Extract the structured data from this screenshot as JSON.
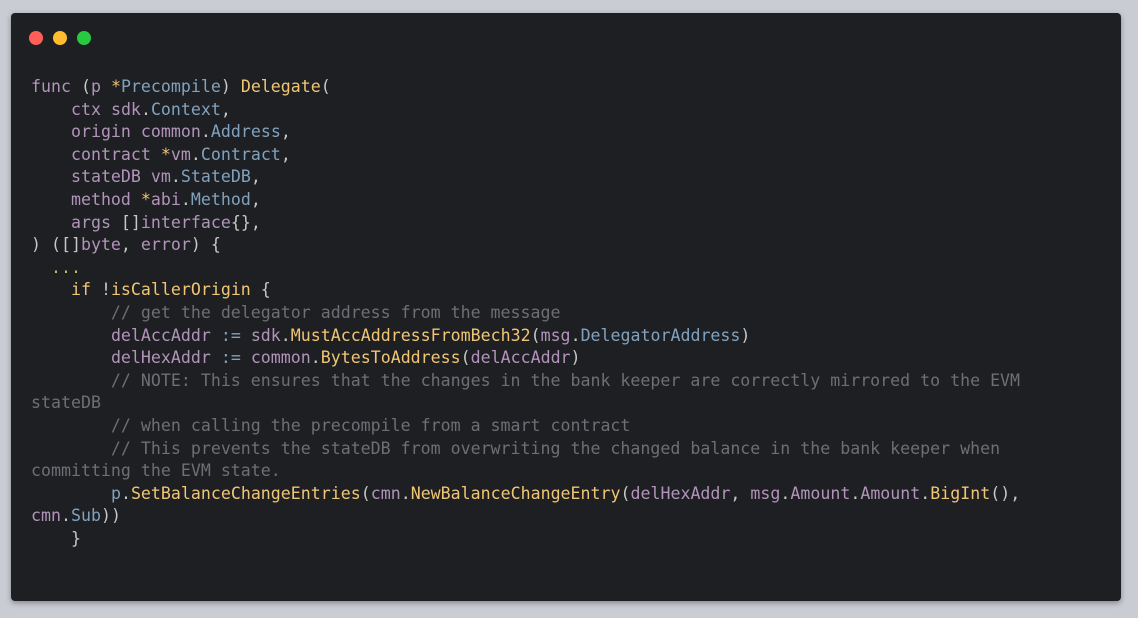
{
  "window": {
    "controls": [
      {
        "name": "close",
        "color": "#ff5f57"
      },
      {
        "name": "minimize",
        "color": "#febc2e"
      },
      {
        "name": "zoom",
        "color": "#28c840"
      }
    ]
  },
  "colors": {
    "keyword": "#b294bb",
    "type": "#81a2be",
    "func": "#f0c674",
    "plain": "#c5c8c6",
    "comment": "#6c6f73",
    "ellipsis": "#b5bd68"
  },
  "code": {
    "lines": [
      [
        [
          "func",
          "keyword"
        ],
        [
          " (",
          "plain"
        ],
        [
          "p",
          "keyword"
        ],
        [
          " *",
          "func"
        ],
        [
          "Precompile",
          "type"
        ],
        [
          ") ",
          "plain"
        ],
        [
          "Delegate",
          "func"
        ],
        [
          "(",
          "plain"
        ]
      ],
      [
        [
          "    ",
          "plain"
        ],
        [
          "ctx",
          "keyword"
        ],
        [
          " ",
          "plain"
        ],
        [
          "sdk",
          "keyword"
        ],
        [
          ".",
          "plain"
        ],
        [
          "Context",
          "type"
        ],
        [
          ",",
          "plain"
        ]
      ],
      [
        [
          "    ",
          "plain"
        ],
        [
          "origin",
          "keyword"
        ],
        [
          " ",
          "plain"
        ],
        [
          "common",
          "keyword"
        ],
        [
          ".",
          "plain"
        ],
        [
          "Address",
          "type"
        ],
        [
          ",",
          "plain"
        ]
      ],
      [
        [
          "    ",
          "plain"
        ],
        [
          "contract",
          "keyword"
        ],
        [
          " *",
          "func"
        ],
        [
          "vm",
          "keyword"
        ],
        [
          ".",
          "plain"
        ],
        [
          "Contract",
          "type"
        ],
        [
          ",",
          "plain"
        ]
      ],
      [
        [
          "    ",
          "plain"
        ],
        [
          "stateDB",
          "keyword"
        ],
        [
          " ",
          "plain"
        ],
        [
          "vm",
          "keyword"
        ],
        [
          ".",
          "plain"
        ],
        [
          "StateDB",
          "type"
        ],
        [
          ",",
          "plain"
        ]
      ],
      [
        [
          "    ",
          "plain"
        ],
        [
          "method",
          "keyword"
        ],
        [
          " *",
          "func"
        ],
        [
          "abi",
          "keyword"
        ],
        [
          ".",
          "plain"
        ],
        [
          "Method",
          "type"
        ],
        [
          ",",
          "plain"
        ]
      ],
      [
        [
          "    ",
          "plain"
        ],
        [
          "args",
          "keyword"
        ],
        [
          " []",
          "plain"
        ],
        [
          "interface",
          "keyword"
        ],
        [
          "{},",
          "plain"
        ]
      ],
      [
        [
          ") ([]",
          "plain"
        ],
        [
          "byte",
          "keyword"
        ],
        [
          ", ",
          "plain"
        ],
        [
          "error",
          "keyword"
        ],
        [
          ") {",
          "plain"
        ]
      ],
      [
        [
          "  ...",
          "ellipsis"
        ]
      ],
      [
        [
          "    ",
          "plain"
        ],
        [
          "if",
          "func"
        ],
        [
          " !",
          "plain"
        ],
        [
          "isCallerOrigin",
          "func"
        ],
        [
          " {",
          "plain"
        ]
      ],
      [
        [
          "        // get the delegator address from the message",
          "comment"
        ]
      ],
      [
        [
          "        ",
          "plain"
        ],
        [
          "delAccAddr",
          "keyword"
        ],
        [
          " := ",
          "type"
        ],
        [
          "sdk",
          "keyword"
        ],
        [
          ".",
          "plain"
        ],
        [
          "MustAccAddressFromBech32",
          "func"
        ],
        [
          "(",
          "plain"
        ],
        [
          "msg",
          "keyword"
        ],
        [
          ".",
          "plain"
        ],
        [
          "DelegatorAddress",
          "type"
        ],
        [
          ")",
          "plain"
        ]
      ],
      [
        [
          "        ",
          "plain"
        ],
        [
          "delHexAddr",
          "keyword"
        ],
        [
          " := ",
          "type"
        ],
        [
          "common",
          "keyword"
        ],
        [
          ".",
          "plain"
        ],
        [
          "BytesToAddress",
          "func"
        ],
        [
          "(",
          "plain"
        ],
        [
          "delAccAddr",
          "keyword"
        ],
        [
          ")",
          "plain"
        ]
      ],
      [
        [
          "        // NOTE: This ensures that the changes in the bank keeper are correctly mirrored to the EVM",
          "comment"
        ]
      ],
      [
        [
          "stateDB",
          "comment"
        ]
      ],
      [
        [
          "        // when calling the precompile from a smart contract",
          "comment"
        ]
      ],
      [
        [
          "        // This prevents the stateDB from overwriting the changed balance in the bank keeper when",
          "comment"
        ]
      ],
      [
        [
          "committing the EVM state.",
          "comment"
        ]
      ],
      [
        [
          "        ",
          "plain"
        ],
        [
          "p",
          "type"
        ],
        [
          ".",
          "plain"
        ],
        [
          "SetBalanceChangeEntries",
          "func"
        ],
        [
          "(",
          "plain"
        ],
        [
          "cmn",
          "keyword"
        ],
        [
          ".",
          "plain"
        ],
        [
          "NewBalanceChangeEntry",
          "func"
        ],
        [
          "(",
          "plain"
        ],
        [
          "delHexAddr",
          "keyword"
        ],
        [
          ", ",
          "plain"
        ],
        [
          "msg",
          "keyword"
        ],
        [
          ".",
          "plain"
        ],
        [
          "Amount",
          "keyword"
        ],
        [
          ".",
          "plain"
        ],
        [
          "Amount",
          "keyword"
        ],
        [
          ".",
          "plain"
        ],
        [
          "BigInt",
          "func"
        ],
        [
          "(),",
          "plain"
        ]
      ],
      [
        [
          "cmn",
          "keyword"
        ],
        [
          ".",
          "plain"
        ],
        [
          "Sub",
          "type"
        ],
        [
          "))",
          "plain"
        ]
      ],
      [
        [
          "    }",
          "plain"
        ]
      ]
    ]
  }
}
